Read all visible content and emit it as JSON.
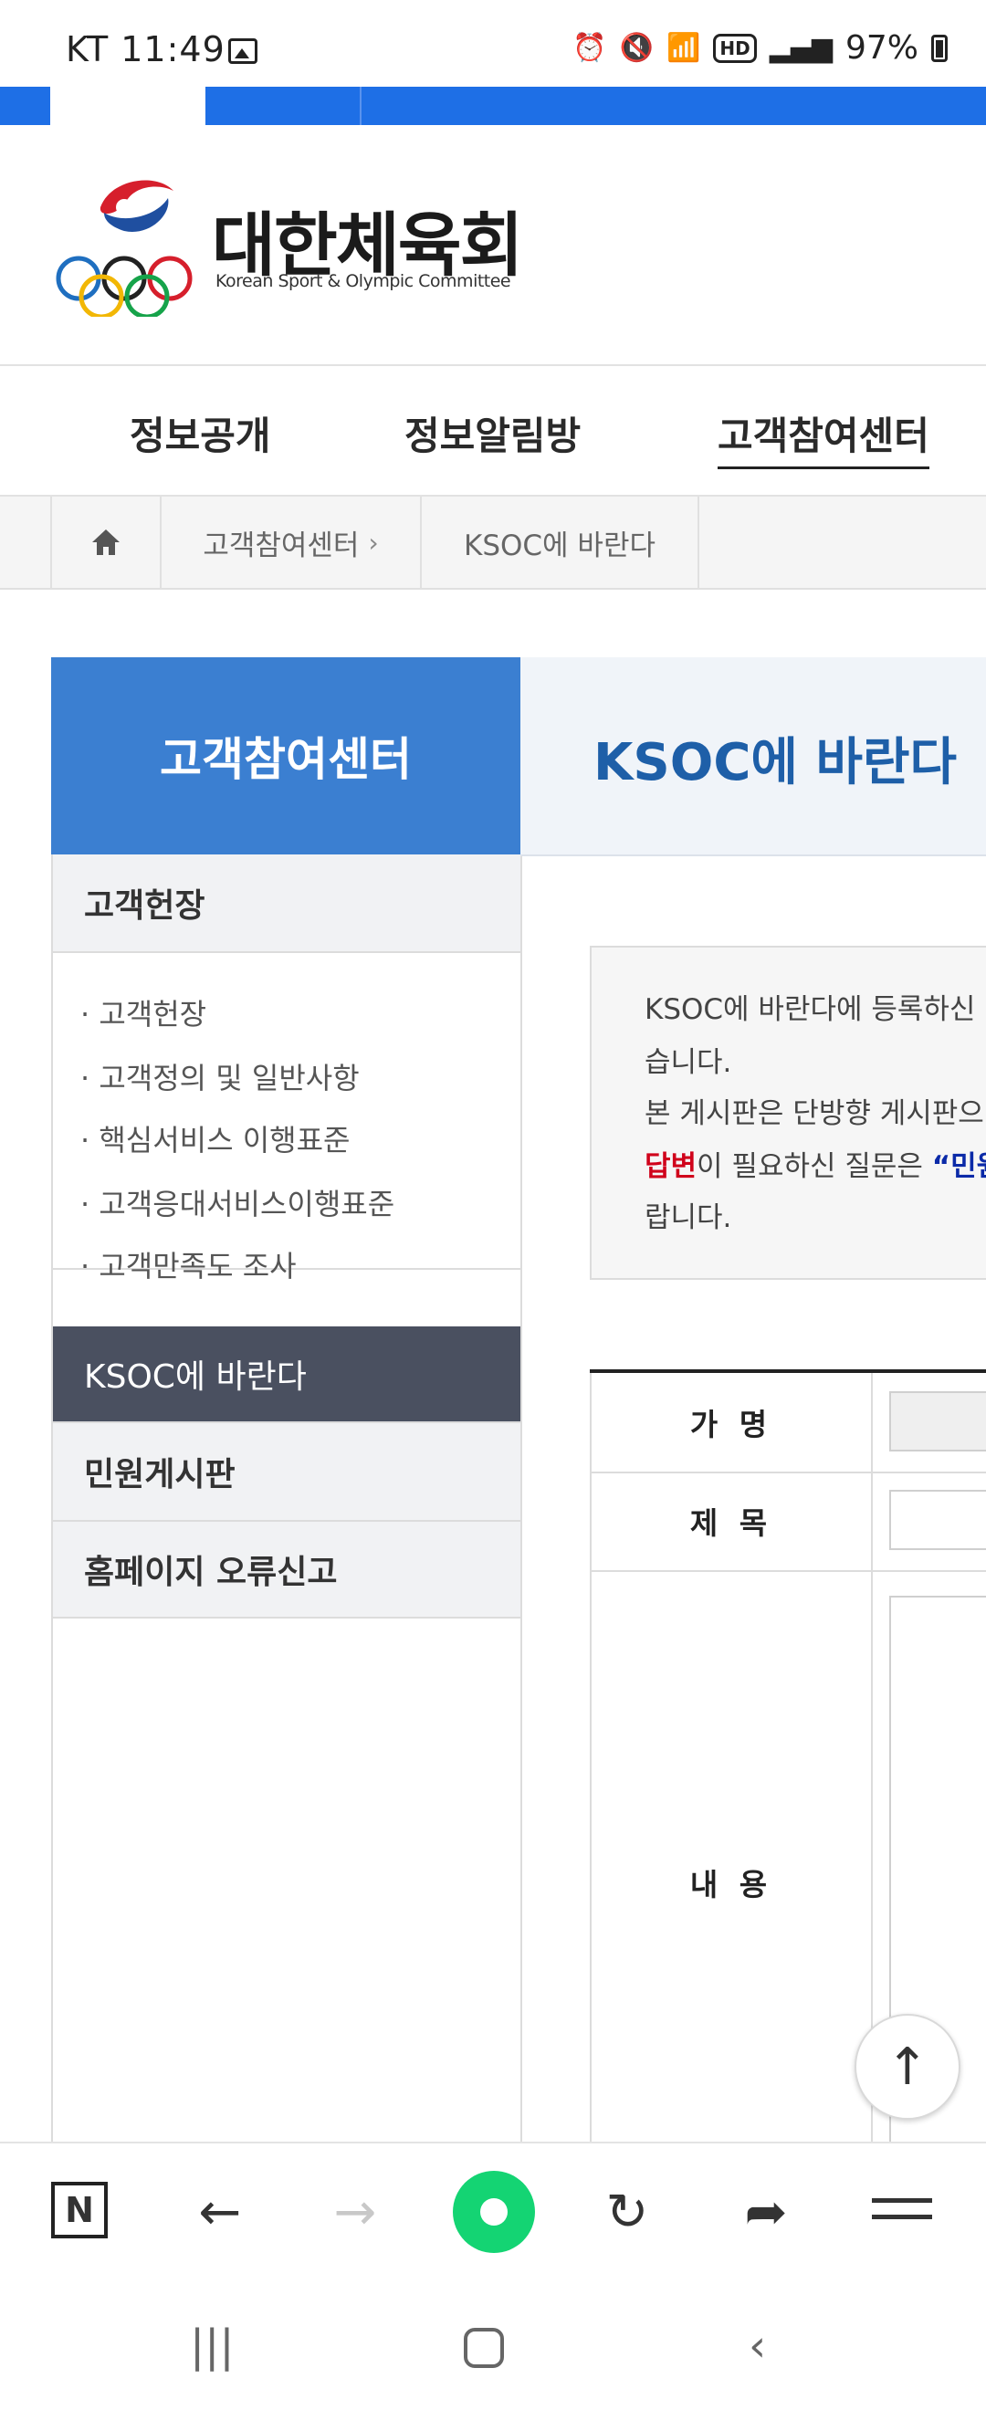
{
  "status_bar": {
    "carrier_time": "KT 11:49",
    "battery": "97%",
    "icons": [
      "image-icon",
      "alarm-icon",
      "mute-icon",
      "wifi-icon",
      "hd-icon",
      "signal-icon",
      "battery-icon"
    ]
  },
  "logo": {
    "name_ko": "대한체육회",
    "name_en": "Korean Sport & Olympic Committee"
  },
  "gnb": {
    "items": [
      "정보공개",
      "정보알림방",
      "고객참여센터"
    ]
  },
  "breadcrumb": {
    "home_icon": "home-icon",
    "level1": "고객참여센터",
    "level2": "KSOC에 바란다"
  },
  "sidebar": {
    "title": "고객참여센터",
    "section1": "고객헌장",
    "sub_items": [
      "· 고객헌장",
      "· 고객정의 및 일반사항",
      "· 핵심서비스 이행표준",
      "· 고객응대서비스이행표준",
      "· 고객만족도 조사"
    ],
    "active": "KSOC에 바란다",
    "item_complaints": "민원게시판",
    "item_error_report": "홈페이지 오류신고"
  },
  "content": {
    "title": "KSOC에 바란다",
    "notice": {
      "line1": "KSOC에 바란다에 등록하신 I",
      "line2": "습니다.",
      "line3": "본 게시판은 단방향 게시판으",
      "line4_red": "답변",
      "line4_rest": "이 필요하신 질문은 ",
      "line4_navy": "“민원",
      "line5": "랍니다."
    },
    "form": {
      "name_label": "가 명",
      "subject_label": "제 목",
      "body_label": "내 용"
    }
  },
  "colors": {
    "brand_blue": "#3b7fd1",
    "title_blue": "#1e5fa8",
    "active_gray": "#4a5060",
    "browser_green": "#14d473"
  }
}
